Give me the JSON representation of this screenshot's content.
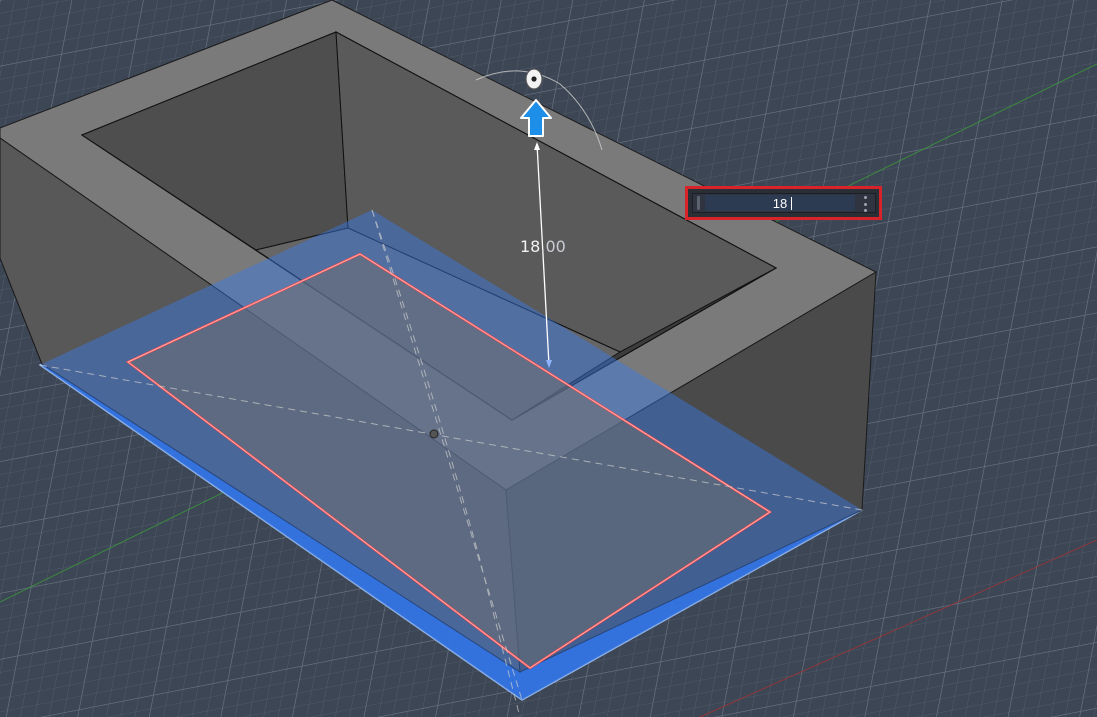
{
  "viewport": {
    "background_color": "#3d4654",
    "grid_color": "#5b6675",
    "body_color": "#585858",
    "selection_color": "#2f6fd8",
    "selected_edge_color": "#ff4d4d",
    "axis_x_color": "#b03030",
    "axis_y_color": "#3a9a3a"
  },
  "manipulator": {
    "dimension_label_main": "18",
    "dimension_label_rest": ".00",
    "arrow_icon": "arrow-up-icon",
    "rotate_handle_icon": "rotate-handle-icon"
  },
  "dimension_input": {
    "value": "18",
    "menu_icon": "kebab-menu-icon"
  }
}
